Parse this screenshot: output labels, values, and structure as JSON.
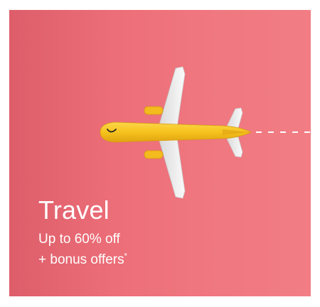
{
  "promo": {
    "title": "Travel",
    "line1": "Up to 60% off",
    "line2": "+ bonus offers",
    "asterisk": "*"
  },
  "colors": {
    "background_left": "#dd5e6a",
    "background_right": "#f27d84",
    "plane_body": "#f6c21c",
    "wing": "#f2f2f2",
    "text": "#ffffff"
  },
  "icons": {
    "illustration": "airplane-icon",
    "path": "dashed-flight-path"
  }
}
